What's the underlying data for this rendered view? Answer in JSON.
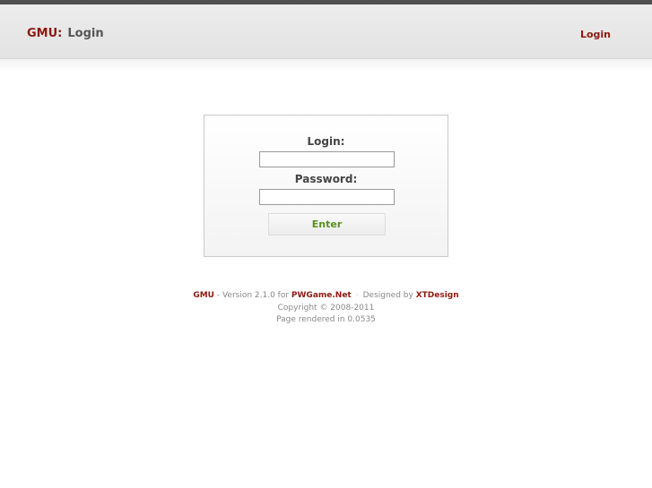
{
  "header": {
    "brand": "GMU",
    "separator": ":",
    "page_title": "Login",
    "login_link": "Login"
  },
  "login_form": {
    "login_label": "Login:",
    "login_value": "",
    "password_label": "Password:",
    "password_value": "",
    "enter_button": "Enter"
  },
  "footer": {
    "app_name": "GMU",
    "version_text": " - Version 2.1.0 for ",
    "site_name": "PWGame.Net",
    "separator": "·",
    "designed_by_text": "Designed by ",
    "designer": "XTDesign",
    "copyright": "Copyright © 2008-2011",
    "render_text": "Page rendered in 0.0535"
  },
  "colors": {
    "brand": "#8b1a10",
    "enter_text": "#5a8f1f",
    "top_stripe": "#4f4f4f"
  }
}
